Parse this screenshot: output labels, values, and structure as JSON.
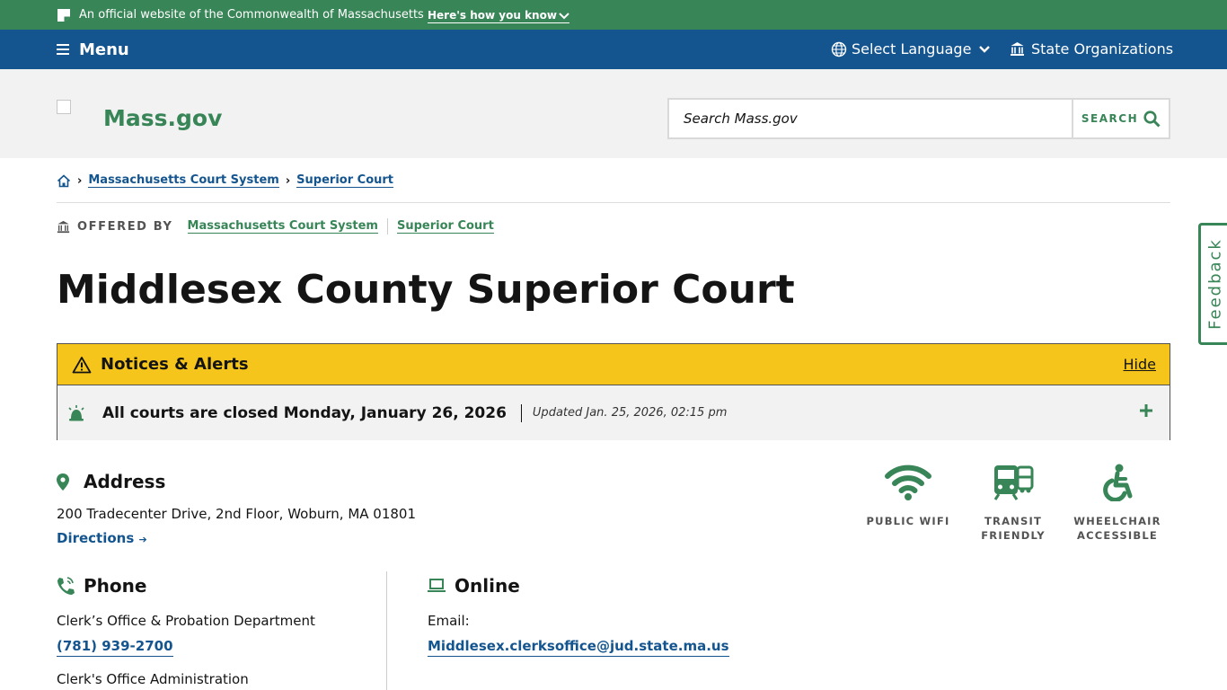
{
  "official_banner": {
    "text": "An official website of the Commonwealth of Massachusetts",
    "toggle_label": "Here's how you know"
  },
  "utility_nav": {
    "menu_label": "Menu",
    "language_label": "Select Language",
    "state_orgs_label": "State Organizations"
  },
  "header": {
    "site_name": "Mass.gov",
    "search_placeholder": "Search Mass.gov",
    "search_button": "SEARCH"
  },
  "breadcrumb": {
    "items": [
      "Massachusetts Court System",
      "Superior Court"
    ]
  },
  "offered_by": {
    "label": "OFFERED BY",
    "orgs": [
      "Massachusetts Court System",
      "Superior Court"
    ]
  },
  "page_title": "Middlesex County Superior Court",
  "alert": {
    "title": "Notices & Alerts",
    "hide_label": "Hide",
    "message": "All courts are closed Monday, January 26, 2026",
    "updated": "Updated Jan. 25, 2026, 02:15 pm"
  },
  "address": {
    "heading": "Address",
    "line": "200 Tradecenter Drive, 2nd Floor, Woburn, MA 01801",
    "directions_label": "Directions"
  },
  "amenities": [
    {
      "label": "PUBLIC WIFI",
      "icon": "wifi-icon"
    },
    {
      "label_line1": "TRANSIT",
      "label_line2": "FRIENDLY",
      "icon": "transit-icon"
    },
    {
      "label_line1": "WHEELCHAIR",
      "label_line2": "ACCESSIBLE",
      "icon": "wheelchair-icon"
    }
  ],
  "phone": {
    "heading": "Phone",
    "entries": [
      {
        "label": "Clerk’s Office & Probation Department",
        "number": "(781) 939-2700"
      },
      {
        "label": "Clerk's Office Administration"
      }
    ]
  },
  "online": {
    "heading": "Online",
    "email_label": "Email:",
    "email": "Middlesex.clerksoffice@jud.state.ma.us"
  },
  "feedback_label": "Feedback",
  "colors": {
    "green": "#388557",
    "blue": "#14558f",
    "alert_yellow": "#f6c51b"
  }
}
